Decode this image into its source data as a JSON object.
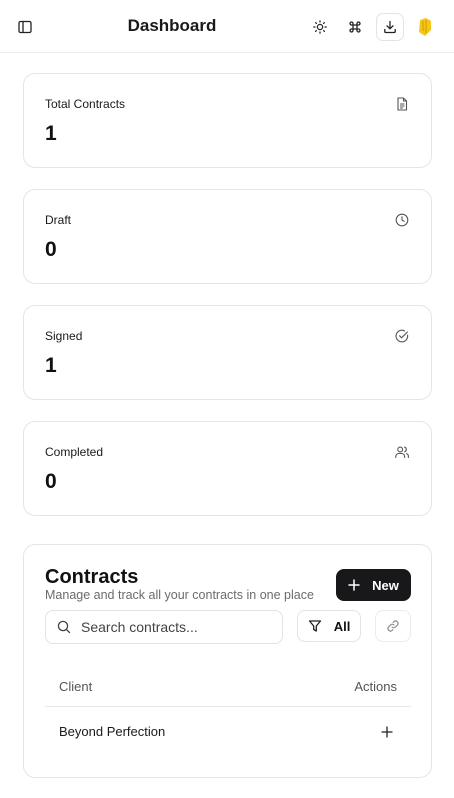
{
  "header": {
    "title": "Dashboard",
    "icons": [
      "sidebar-toggle-icon",
      "sun-icon",
      "command-icon",
      "download-icon",
      "avatar-logo"
    ]
  },
  "stats": [
    {
      "label": "Total Contracts",
      "value": "1",
      "icon": "file-text-icon"
    },
    {
      "label": "Draft",
      "value": "0",
      "icon": "clock-icon"
    },
    {
      "label": "Signed",
      "value": "1",
      "icon": "check-circle-icon"
    },
    {
      "label": "Completed",
      "value": "0",
      "icon": "users-icon"
    }
  ],
  "contracts": {
    "title": "Contracts",
    "subtitle": "Manage and track all your contracts in one place",
    "new_button_label": "New",
    "search_placeholder": "Search contracts...",
    "search_value": "",
    "filter_label": "All",
    "columns": {
      "client": "Client",
      "actions": "Actions"
    },
    "rows": [
      {
        "client": "Beyond Perfection"
      }
    ]
  },
  "colors": {
    "primary_button": "#18181b",
    "card_border": "#e5e5e5",
    "avatar_accent": "#f5c518"
  }
}
